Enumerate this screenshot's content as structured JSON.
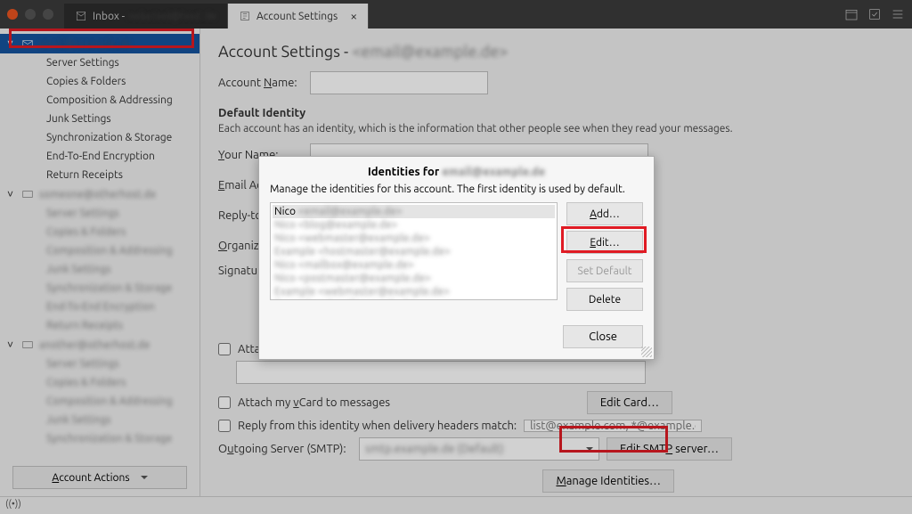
{
  "titlebar": {
    "tab_inbox": "Inbox - ",
    "tab_settings": "Account Settings"
  },
  "sidebar": {
    "account1": {
      "name": "email@example.de",
      "items": [
        "Server Settings",
        "Copies & Folders",
        "Composition & Addressing",
        "Junk Settings",
        "Synchronization & Storage",
        "End-To-End Encryption",
        "Return Receipts"
      ]
    },
    "blurred_accounts": 2,
    "account_actions": "Account Actions"
  },
  "main": {
    "title_prefix": "Account Settings - ",
    "account_name_label": "Account Name:",
    "default_identity": "Default Identity",
    "default_identity_desc": "Each account has an identity, which is the information that other people see when they read your messages.",
    "your_name": "Your Name:",
    "email_addr": "Email Address:",
    "reply_to": "Reply-to Address:",
    "organization": "Organization:",
    "signature": "Signature text:",
    "attach_sig": "Attach the signature from a file instead (text, HTML, or image)",
    "attach_vcard": "Attach my vCard to messages",
    "edit_card": "Edit Card…",
    "reply_match": "Reply from this identity when delivery headers match:",
    "reply_placeholder": "list@example.com, *@example.com",
    "smtp_label": "Outgoing Server (SMTP):",
    "edit_smtp": "Edit SMTP server…",
    "manage_ids": "Manage Identities…"
  },
  "dialog": {
    "title_prefix": "Identities for ",
    "subtitle": "Manage the identities for this account. The first identity is used by default.",
    "first_identity": "Nico ",
    "btn_add": "Add…",
    "btn_edit": "Edit…",
    "btn_default": "Set Default",
    "btn_delete": "Delete",
    "btn_close": "Close"
  }
}
